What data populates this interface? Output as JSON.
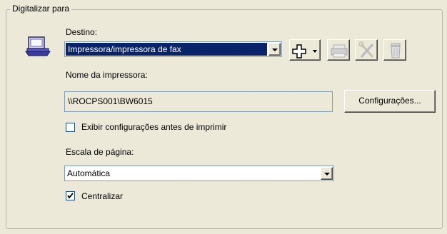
{
  "group": {
    "title": "Digitalizar para"
  },
  "destination": {
    "label": "Destino:",
    "selected": "Impressora/impressora de fax"
  },
  "printer": {
    "label": "Nome da impressora:",
    "value": "\\\\ROCPS001\\BW6015",
    "settings_button": "Configurações..."
  },
  "show_settings_checkbox": {
    "label": "Exibir configurações antes de imprimir",
    "checked": false
  },
  "page_scale": {
    "label": "Escala de página:",
    "selected": "Automática"
  },
  "center_checkbox": {
    "label": "Centralizar",
    "checked": true
  },
  "colors": {
    "selection": "#0a246a",
    "face": "#ece9d8"
  }
}
